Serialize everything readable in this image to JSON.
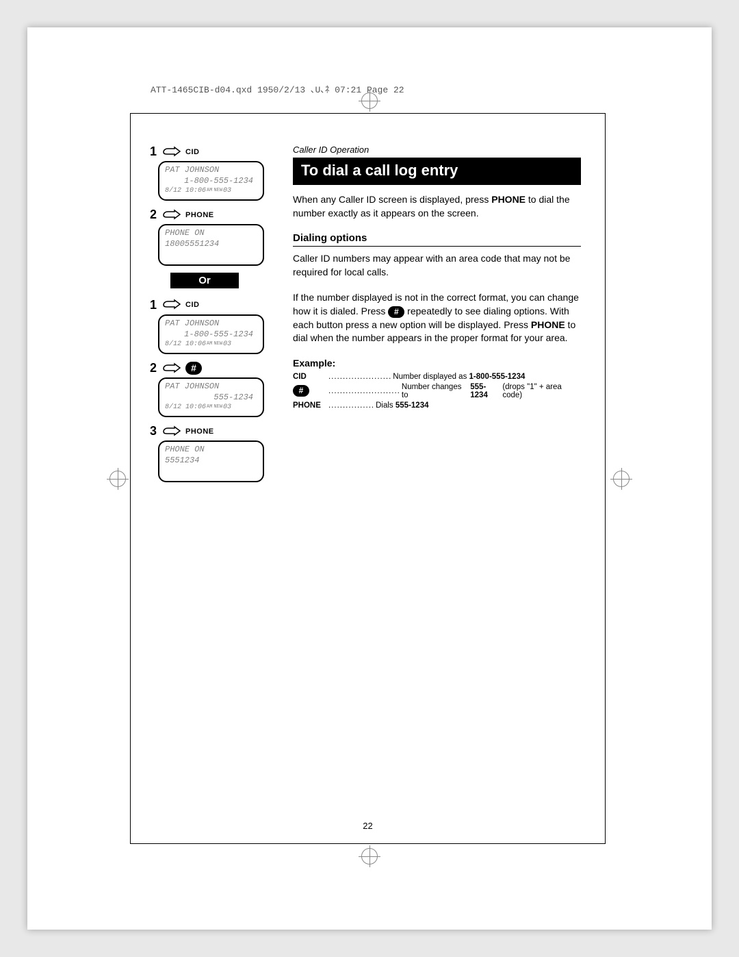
{
  "job_header": "ATT-1465CIB-d04.qxd  1950/2/13  ､U､ﾈ 07:21  Page 22",
  "page_number": "22",
  "section_label": "Caller ID Operation",
  "title": "To dial a call log entry",
  "intro_text_a": "When any Caller ID screen is displayed, press ",
  "intro_phone": "PHONE",
  "intro_text_b": " to dial the number exactly as it appears on the screen.",
  "subhead_dialing": "Dialing options",
  "dial_p1": "Caller ID numbers may appear with an area code that may not be required for local calls.",
  "dial_p2a": "If the number displayed is not in the correct format, you can change how it is dialed. Press ",
  "dial_p2b": " repeatedly to see dialing options. With each button press a new option will be displayed. Press ",
  "dial_p2_phone": "PHONE",
  "dial_p2c": " to dial when the number appears in the proper format for your area.",
  "subhead_example": "Example:",
  "example": {
    "cid_key": "CID",
    "cid_dots": "......................",
    "cid_text_a": "Number displayed as ",
    "cid_text_b": "1-800-555-1234",
    "hash_dots": ".........................",
    "hash_text_a": "Number changes to ",
    "hash_text_b": "555-1234",
    "hash_text_c": " (drops \"1\" + area code)",
    "phone_key": "PHONE",
    "phone_dots": "................",
    "phone_text_a": "Dials ",
    "phone_text_b": "555-1234"
  },
  "sidebar": {
    "seqA": {
      "step1": {
        "num": "1",
        "label": "CID"
      },
      "lcd1": {
        "line1": "PAT JOHNSON",
        "line2": "1-800-555-1234",
        "date": "8/12 10:06",
        "ampm": "AM",
        "newtag": "NEW",
        "count": "03"
      },
      "step2": {
        "num": "2",
        "label": "PHONE"
      },
      "lcd2": {
        "line1": "PHONE ON",
        "line2": "18005551234"
      }
    },
    "or_label": "Or",
    "seqB": {
      "step1": {
        "num": "1",
        "label": "CID"
      },
      "lcd1": {
        "line1": "PAT JOHNSON",
        "line2": "1-800-555-1234",
        "date": "8/12 10:06",
        "ampm": "AM",
        "newtag": "NEW",
        "count": "03"
      },
      "step2": {
        "num": "2",
        "hash": "#"
      },
      "lcd2": {
        "line1": "PAT JOHNSON",
        "line2": "555-1234",
        "date": "8/12 10:06",
        "ampm": "AM",
        "newtag": "NEW",
        "count": "03"
      },
      "step3": {
        "num": "3",
        "label": "PHONE"
      },
      "lcd3": {
        "line1": "PHONE ON",
        "line2": "5551234"
      }
    }
  }
}
